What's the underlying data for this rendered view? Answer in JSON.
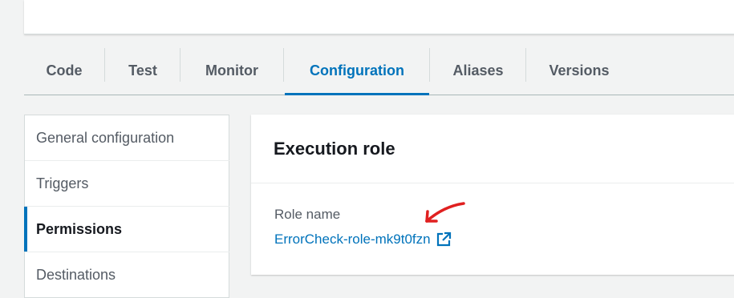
{
  "tabs": [
    {
      "label": "Code"
    },
    {
      "label": "Test"
    },
    {
      "label": "Monitor"
    },
    {
      "label": "Configuration"
    },
    {
      "label": "Aliases"
    },
    {
      "label": "Versions"
    }
  ],
  "active_tab": "Configuration",
  "sidenav": {
    "items": [
      {
        "label": "General configuration"
      },
      {
        "label": "Triggers"
      },
      {
        "label": "Permissions"
      },
      {
        "label": "Destinations"
      }
    ],
    "active": "Permissions"
  },
  "panel": {
    "title": "Execution role",
    "field_label": "Role name",
    "role_link": "ErrorCheck-role-mk9t0fzn"
  },
  "colors": {
    "accent": "#0073bb",
    "annotation": "#e02020"
  },
  "icons": {
    "external_link": "external-link-icon",
    "annotation": "red-arrow-annotation"
  }
}
